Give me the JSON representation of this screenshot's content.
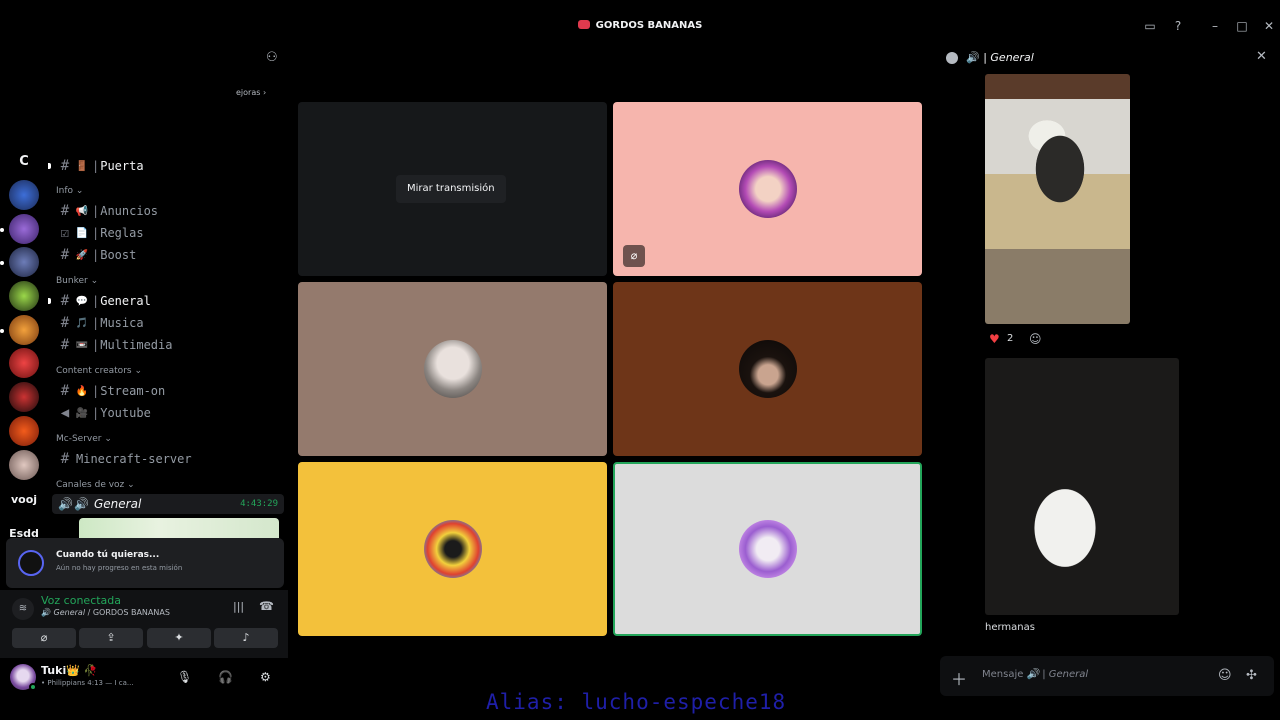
{
  "window": {
    "title": "GORDOS BANANAS"
  },
  "rail": {
    "letter": "C",
    "text1": "vooj",
    "text2": "Esdd"
  },
  "sidebar": {
    "mejoras": "ejoras ›",
    "top_channel": {
      "emoji": "🚪",
      "name": "Puerta"
    },
    "categories": {
      "info": "Info ⌄",
      "bunker": "Bunker ⌄",
      "creators": "Content creators ⌄",
      "mc": "Mc-Server ⌄",
      "voice": "Canales de voz ⌄"
    },
    "channels": {
      "anuncios": {
        "emoji": "📢",
        "name": "Anuncios"
      },
      "reglas": {
        "emoji": "📄",
        "name": "Reglas"
      },
      "boost": {
        "emoji": "🚀",
        "name": "Boost"
      },
      "general": {
        "emoji": "💬",
        "name": "General"
      },
      "musica": {
        "emoji": "🎵",
        "name": "Musica"
      },
      "multimedia": {
        "emoji": "📼",
        "name": "Multimedia"
      },
      "stream": {
        "emoji": "🔥",
        "name": "Stream-on"
      },
      "youtube": {
        "emoji": "🎥",
        "name": "Youtube"
      },
      "minecraft": {
        "name": "Minecraft-server"
      }
    },
    "voice_channel": {
      "name": "General",
      "time": "4:43:29"
    }
  },
  "mission": {
    "title": "Cuando tú quieras...",
    "subtitle": "Aún no hay progreso en esta misión"
  },
  "voice": {
    "status": "Voz conectada",
    "channel": "General",
    "server": " / GORDOS BANANAS"
  },
  "user": {
    "name": "Tuki👑 🥀",
    "status": "• Philippians 4:13 — I ca..."
  },
  "grid": {
    "watch_label": "Mirar transmisión"
  },
  "chat": {
    "title": "General",
    "reaction_count": "2",
    "caption": "hermanas",
    "placeholder_prefix": "Mensaje",
    "placeholder_channel": "General"
  },
  "overlay": {
    "alias": "Alias: lucho-espeche18"
  },
  "colors": {
    "accent_green": "#23a55a",
    "blurple": "#5865f2",
    "muted_red": "#f23f43"
  }
}
